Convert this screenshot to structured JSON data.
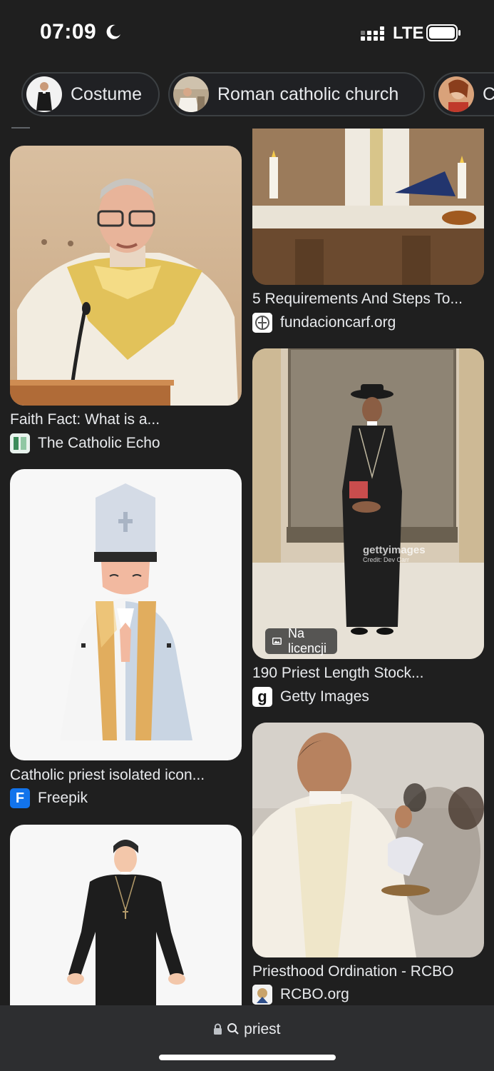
{
  "status_bar": {
    "time": "07:09",
    "network": "LTE"
  },
  "chips": [
    {
      "label": "Costume"
    },
    {
      "label": "Roman catholic church"
    },
    {
      "label": "C"
    }
  ],
  "results": [
    {
      "title": "Faith Fact: What is a...",
      "source": "The Catholic Echo"
    },
    {
      "title": "5 Requirements And Steps To...",
      "source": "fundacioncarf.org"
    },
    {
      "title": "Catholic priest isolated icon...",
      "source": "Freepik"
    },
    {
      "title": "190 Priest Length Stock...",
      "source": "Getty Images",
      "badge": "Na licencji",
      "watermark": "gettyimages",
      "watermark_credit": "Credit: Dev Carr"
    },
    {
      "title": "Priesthood Ordination - RCBO",
      "source": "RCBO.org"
    }
  ],
  "favicons": {
    "freepik": "F",
    "getty": "g"
  },
  "address_bar": {
    "query": "priest"
  },
  "colors": {
    "background": "#1f1f1f",
    "bottom_bar": "#2d2e30",
    "chip_border": "#3c4043",
    "freepik": "#1273eb"
  }
}
